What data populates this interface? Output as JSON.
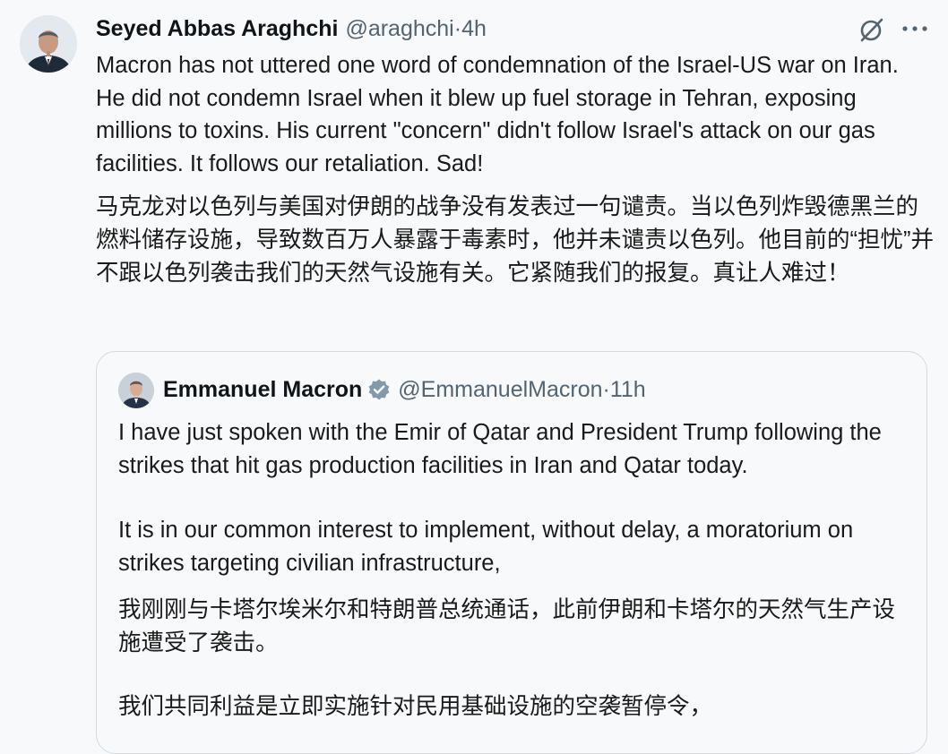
{
  "tweet": {
    "author": {
      "display_name": "Seyed Abbas Araghchi",
      "handle": "@araghchi",
      "separator": " · ",
      "time": "4h"
    },
    "body_en": "Macron has not uttered one word of condemnation of the Israel-US war on Iran. He did not condemn Israel when it blew up fuel storage in Tehran, exposing millions to toxins. His current \"concern\" didn't follow Israel's attack on our gas facilities. It follows our retaliation. Sad!",
    "body_zh": "马克龙对以色列与美国对伊朗的战争没有发表过一句谴责。当以色列炸毁德黑兰的燃料储存设施，导致数百万人暴露于毒素时，他并未谴责以色列。他目前的“担忧”并不跟以色列袭击我们的天然气设施有关。它紧随我们的报复。真让人难过！",
    "icons": {
      "grok": "grok-icon",
      "more": "more-icon"
    }
  },
  "quoted_tweet": {
    "author": {
      "display_name": "Emmanuel Macron",
      "handle": "@EmmanuelMacron",
      "separator": " · ",
      "time": "11h",
      "verified_icon": "verified-badge-icon"
    },
    "para1_en": "I have just spoken with the Emir of Qatar and President Trump following the strikes that hit gas production facilities in Iran and Qatar today.",
    "para2_en": "It is in our common interest to implement, without delay, a moratorium on strikes targeting civilian infrastructure,",
    "para1_zh": "我刚刚与卡塔尔埃米尔和特朗普总统通话，此前伊朗和卡塔尔的天然气生产设施遭受了袭击。",
    "para2_zh": "我们共同利益是立即实施针对民用基础设施的空袭暂停令，"
  },
  "colors": {
    "background": "#f7f9fa",
    "text": "#0f1419",
    "secondary_text": "#536471",
    "border": "#d3dbe1",
    "verified_badge": "#829aab"
  }
}
